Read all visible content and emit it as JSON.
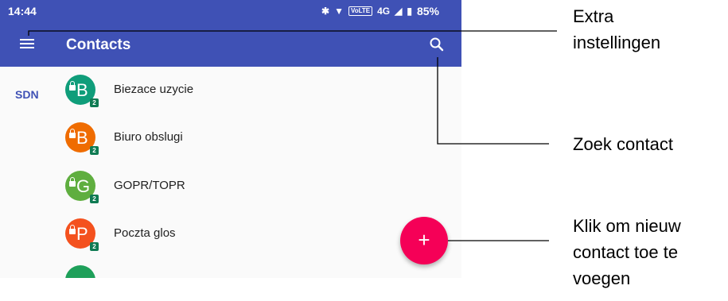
{
  "status_bar": {
    "time": "14:44",
    "network": "4G",
    "volte": "VoLTE",
    "battery": "85%"
  },
  "app_bar": {
    "title": "Contacts",
    "color": "#3f51b5"
  },
  "list": {
    "section_label": "SDN",
    "contacts": [
      {
        "letter": "B",
        "name": "Biezace uzycie",
        "color": "#0f9d7a",
        "sim": "2"
      },
      {
        "letter": "B",
        "name": "Biuro obslugi",
        "color": "#ef6c00",
        "sim": "2"
      },
      {
        "letter": "G",
        "name": "GOPR/TOPR",
        "color": "#5fae3f",
        "sim": "2"
      },
      {
        "letter": "P",
        "name": "Poczta glos",
        "color": "#f4511e",
        "sim": "2"
      },
      {
        "letter": "",
        "name": "",
        "color": "#1ea05a",
        "sim": ""
      }
    ]
  },
  "fab": {
    "symbol": "+",
    "color": "#f50057"
  },
  "annotations": {
    "menu": [
      "Extra",
      "instellingen"
    ],
    "search": [
      "Zoek contact"
    ],
    "add": [
      "Klik om nieuw",
      "contact toe te",
      "voegen"
    ]
  }
}
